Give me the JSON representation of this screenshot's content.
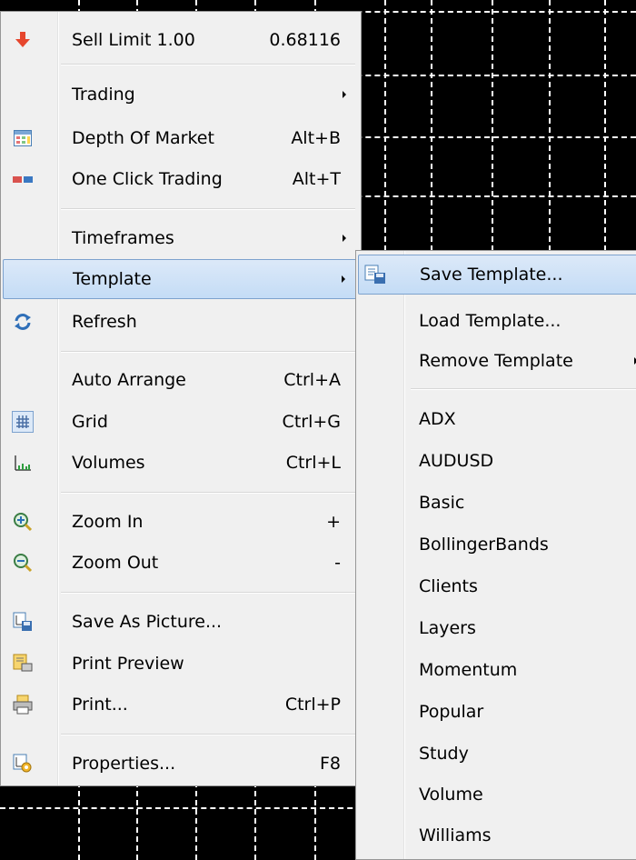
{
  "main_menu": {
    "items": [
      {
        "label": "Sell Limit 1.00",
        "shortcut": "0.68116",
        "icon": "sell-limit-arrow-icon"
      },
      {
        "label": "Trading",
        "submenu": true
      },
      {
        "label": "Depth Of Market",
        "shortcut": "Alt+B",
        "icon": "depth-of-market-icon"
      },
      {
        "label": "One Click Trading",
        "shortcut": "Alt+T",
        "icon": "one-click-trading-icon"
      },
      {
        "label": "Timeframes",
        "submenu": true
      },
      {
        "label": "Template",
        "submenu": true,
        "highlighted": true
      },
      {
        "label": "Refresh",
        "icon": "refresh-icon"
      },
      {
        "label": "Auto Arrange",
        "shortcut": "Ctrl+A"
      },
      {
        "label": "Grid",
        "shortcut": "Ctrl+G",
        "icon": "grid-icon"
      },
      {
        "label": "Volumes",
        "shortcut": "Ctrl+L",
        "icon": "volumes-icon"
      },
      {
        "label": "Zoom In",
        "shortcut": "+",
        "icon": "zoom-in-icon"
      },
      {
        "label": "Zoom Out",
        "shortcut": "-",
        "icon": "zoom-out-icon"
      },
      {
        "label": "Save As Picture...",
        "icon": "save-as-picture-icon"
      },
      {
        "label": "Print Preview",
        "icon": "print-preview-icon"
      },
      {
        "label": "Print...",
        "shortcut": "Ctrl+P",
        "icon": "print-icon"
      },
      {
        "label": "Properties...",
        "shortcut": "F8",
        "icon": "properties-icon"
      }
    ]
  },
  "template_submenu": {
    "items": [
      {
        "label": "Save Template...",
        "highlighted": true,
        "icon": "save-template-icon"
      },
      {
        "label": "Load Template..."
      },
      {
        "label": "Remove Template",
        "submenu": true
      },
      {
        "label": "ADX"
      },
      {
        "label": "AUDUSD"
      },
      {
        "label": "Basic"
      },
      {
        "label": "BollingerBands"
      },
      {
        "label": "Clients"
      },
      {
        "label": "Layers"
      },
      {
        "label": "Momentum"
      },
      {
        "label": "Popular"
      },
      {
        "label": "Study"
      },
      {
        "label": "Volume"
      },
      {
        "label": "Williams"
      }
    ]
  },
  "colors": {
    "menu_bg": "#f0f0f0",
    "highlight_border": "#7da2ce",
    "chart_bg": "#000000",
    "grid": "#ffffff"
  }
}
